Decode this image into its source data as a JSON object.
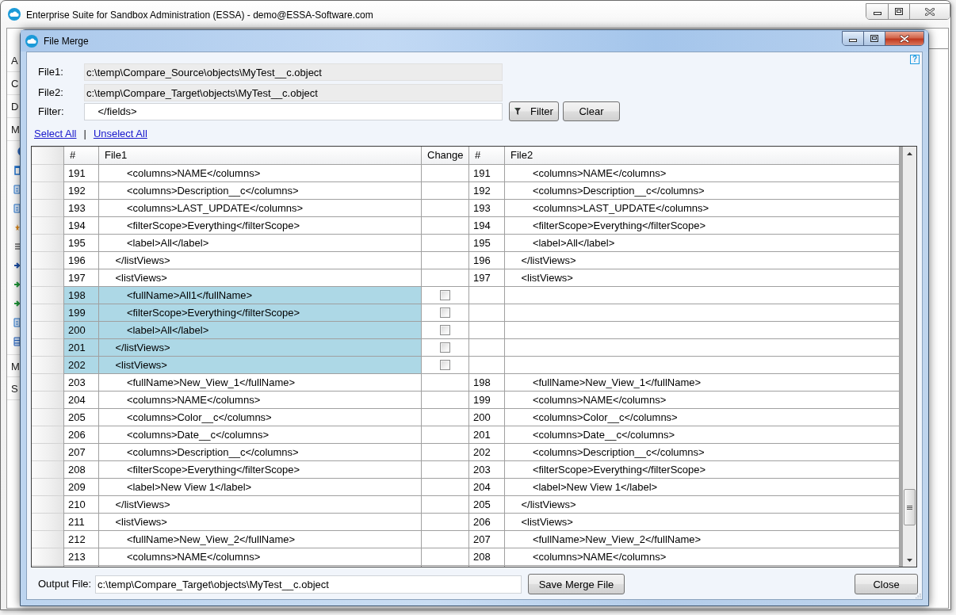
{
  "main_window": {
    "title": "Enterprise Suite for Sandbox Administration (ESSA) - demo@ESSA-Software.com",
    "sidebar": {
      "top_items": [
        "A",
        "C",
        "D",
        "M"
      ],
      "bottom_items": [
        "M",
        "S"
      ]
    }
  },
  "dialog": {
    "title": "File Merge",
    "help": "?",
    "fields": [
      {
        "label": "File1:",
        "value": "c:\\temp\\Compare_Source\\objects\\MyTest__c.object",
        "readonly": true
      },
      {
        "label": "File2:",
        "value": "c:\\temp\\Compare_Target\\objects\\MyTest__c.object",
        "readonly": true
      },
      {
        "label": "Filter:",
        "value": "    </fields>",
        "readonly": false
      }
    ],
    "filter_buttons": [
      {
        "label": "Filter",
        "kind": "with_icon"
      },
      {
        "label": "Clear",
        "kind": "plain"
      }
    ],
    "links": [
      "Select All",
      "Unselect All"
    ],
    "link_separator": "|",
    "table": {
      "columns": [
        "#",
        "File1",
        "Change",
        "#",
        "File2"
      ],
      "rows": [
        {
          "kind": "same",
          "left": {
            "num": "191",
            "text": "        <columns>NAME</columns>"
          },
          "right": {
            "num": "191",
            "text": "        <columns>NAME</columns>"
          }
        },
        {
          "kind": "same",
          "left": {
            "num": "192",
            "text": "        <columns>Description__c</columns>"
          },
          "right": {
            "num": "192",
            "text": "        <columns>Description__c</columns>"
          }
        },
        {
          "kind": "same",
          "left": {
            "num": "193",
            "text": "        <columns>LAST_UPDATE</columns>"
          },
          "right": {
            "num": "193",
            "text": "        <columns>LAST_UPDATE</columns>"
          }
        },
        {
          "kind": "same",
          "left": {
            "num": "194",
            "text": "        <filterScope>Everything</filterScope>"
          },
          "right": {
            "num": "194",
            "text": "        <filterScope>Everything</filterScope>"
          }
        },
        {
          "kind": "same",
          "left": {
            "num": "195",
            "text": "        <label>All</label>"
          },
          "right": {
            "num": "195",
            "text": "        <label>All</label>"
          }
        },
        {
          "kind": "same",
          "left": {
            "num": "196",
            "text": "    </listViews>"
          },
          "right": {
            "num": "196",
            "text": "    </listViews>"
          }
        },
        {
          "kind": "same",
          "left": {
            "num": "197",
            "text": "    <listViews>"
          },
          "right": {
            "num": "197",
            "text": "    <listViews>"
          }
        },
        {
          "kind": "left_only",
          "left": {
            "num": "198",
            "text": "        <fullName>All1</fullName>"
          },
          "checked": false
        },
        {
          "kind": "left_only",
          "left": {
            "num": "199",
            "text": "        <filterScope>Everything</filterScope>"
          },
          "checked": false
        },
        {
          "kind": "left_only",
          "left": {
            "num": "200",
            "text": "        <label>All</label>"
          },
          "checked": false
        },
        {
          "kind": "left_only",
          "left": {
            "num": "201",
            "text": "    </listViews>"
          },
          "checked": false
        },
        {
          "kind": "left_only",
          "left": {
            "num": "202",
            "text": "    <listViews>"
          },
          "checked": false
        },
        {
          "kind": "same",
          "left": {
            "num": "203",
            "text": "        <fullName>New_View_1</fullName>"
          },
          "right": {
            "num": "198",
            "text": "        <fullName>New_View_1</fullName>"
          }
        },
        {
          "kind": "same",
          "left": {
            "num": "204",
            "text": "        <columns>NAME</columns>"
          },
          "right": {
            "num": "199",
            "text": "        <columns>NAME</columns>"
          }
        },
        {
          "kind": "same",
          "left": {
            "num": "205",
            "text": "        <columns>Color__c</columns>"
          },
          "right": {
            "num": "200",
            "text": "        <columns>Color__c</columns>"
          }
        },
        {
          "kind": "same",
          "left": {
            "num": "206",
            "text": "        <columns>Date__c</columns>"
          },
          "right": {
            "num": "201",
            "text": "        <columns>Date__c</columns>"
          }
        },
        {
          "kind": "same",
          "left": {
            "num": "207",
            "text": "        <columns>Description__c</columns>"
          },
          "right": {
            "num": "202",
            "text": "        <columns>Description__c</columns>"
          }
        },
        {
          "kind": "same",
          "left": {
            "num": "208",
            "text": "        <filterScope>Everything</filterScope>"
          },
          "right": {
            "num": "203",
            "text": "        <filterScope>Everything</filterScope>"
          }
        },
        {
          "kind": "same",
          "left": {
            "num": "209",
            "text": "        <label>New View 1</label>"
          },
          "right": {
            "num": "204",
            "text": "        <label>New View 1</label>"
          }
        },
        {
          "kind": "same",
          "left": {
            "num": "210",
            "text": "    </listViews>"
          },
          "right": {
            "num": "205",
            "text": "    </listViews>"
          }
        },
        {
          "kind": "same",
          "left": {
            "num": "211",
            "text": "    <listViews>"
          },
          "right": {
            "num": "206",
            "text": "    <listViews>"
          }
        },
        {
          "kind": "same",
          "left": {
            "num": "212",
            "text": "        <fullName>New_View_2</fullName>"
          },
          "right": {
            "num": "207",
            "text": "        <fullName>New_View_2</fullName>"
          }
        },
        {
          "kind": "same",
          "left": {
            "num": "213",
            "text": "        <columns>NAME</columns>"
          },
          "right": {
            "num": "208",
            "text": "        <columns>NAME</columns>"
          }
        }
      ]
    },
    "output": {
      "label": "Output File:",
      "value": "c:\\temp\\Compare_Target\\objects\\MyTest__c.object"
    },
    "buttons": [
      "Save Merge File",
      "Close"
    ]
  }
}
